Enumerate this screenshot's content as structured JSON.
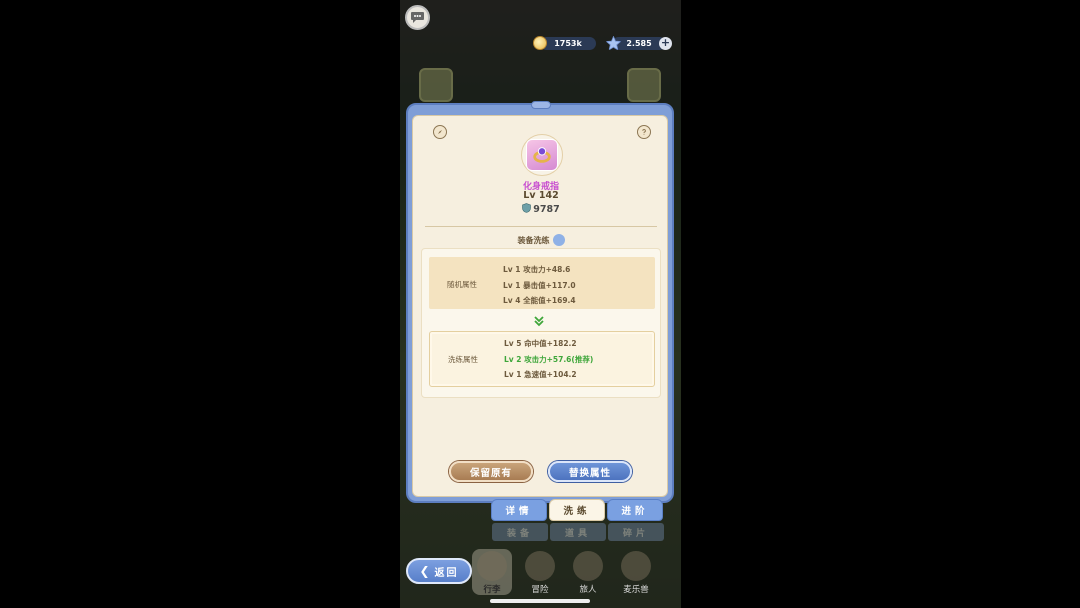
{
  "hud": {
    "gold": "1753k",
    "gems": "2.585",
    "add_label": "+"
  },
  "item": {
    "name": "化身戒指",
    "level": "Lv 142",
    "power": "9787"
  },
  "reforge": {
    "title": "装备洗练",
    "random_label": "随机属性",
    "random_lines": [
      "Lv 1 攻击力+48.6",
      "Lv 1 暴击值+117.0",
      "Lv 4 全能值+169.4"
    ],
    "wash_label": "洗练属性",
    "wash_lines": [
      "Lv 5 命中值+182.2",
      "Lv 2 攻击力+57.6(推荐)",
      "Lv 1 急速值+104.2"
    ]
  },
  "buttons": {
    "keep": "保留原有",
    "swap": "替换属性"
  },
  "tabs": [
    "详情",
    "洗练",
    "进阶"
  ],
  "subtabs": [
    "装备",
    "道具",
    "碎片"
  ],
  "nav": [
    "行李",
    "冒险",
    "旅人",
    "麦乐兽"
  ],
  "back_label": "返回",
  "colors": {
    "accent_blue": "#7aa0e1",
    "panel_bg": "#f6efdf",
    "recommend_green": "#3ea63a",
    "item_name_purple": "#c84fd0"
  }
}
